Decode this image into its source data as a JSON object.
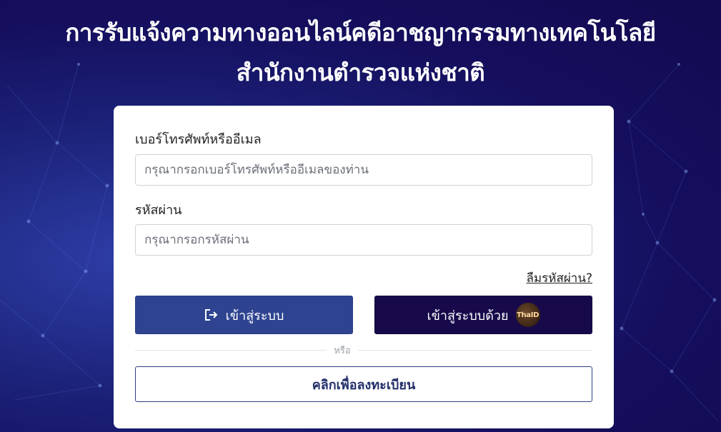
{
  "page": {
    "title_line1": "การรับแจ้งความทางออนไลน์คดีอาชญากรรมทางเทคโนโลยี",
    "title_line2": "สำนักงานตำรวจแห่งชาติ"
  },
  "form": {
    "phone_email_label": "เบอร์โทรศัพท์หรืออีเมล",
    "phone_email_placeholder": "กรุณากรอกเบอร์โทรศัพท์หรืออีเมลของท่าน",
    "phone_email_value": "",
    "password_label": "รหัสผ่าน",
    "password_placeholder": "กรุณากรอกรหัสผ่าน",
    "password_value": "",
    "forgot_password": "ลืมรหัสผ่าน?",
    "login_button": "เข้าสู่ระบบ",
    "thaid_button": "เข้าสู่ระบบด้วย",
    "thaid_logo_text": "ThaID",
    "divider_text": "หรือ",
    "register_button": "คลิกเพื่อลงทะเบียน"
  },
  "icons": {
    "login_icon": "login-arrow-icon",
    "thaid_icon": "thaid-logo-icon"
  },
  "colors": {
    "background": "#1c237a",
    "login_button_bg": "#2e4491",
    "thaid_button_bg": "#17094a",
    "register_border": "#2e3f85"
  }
}
